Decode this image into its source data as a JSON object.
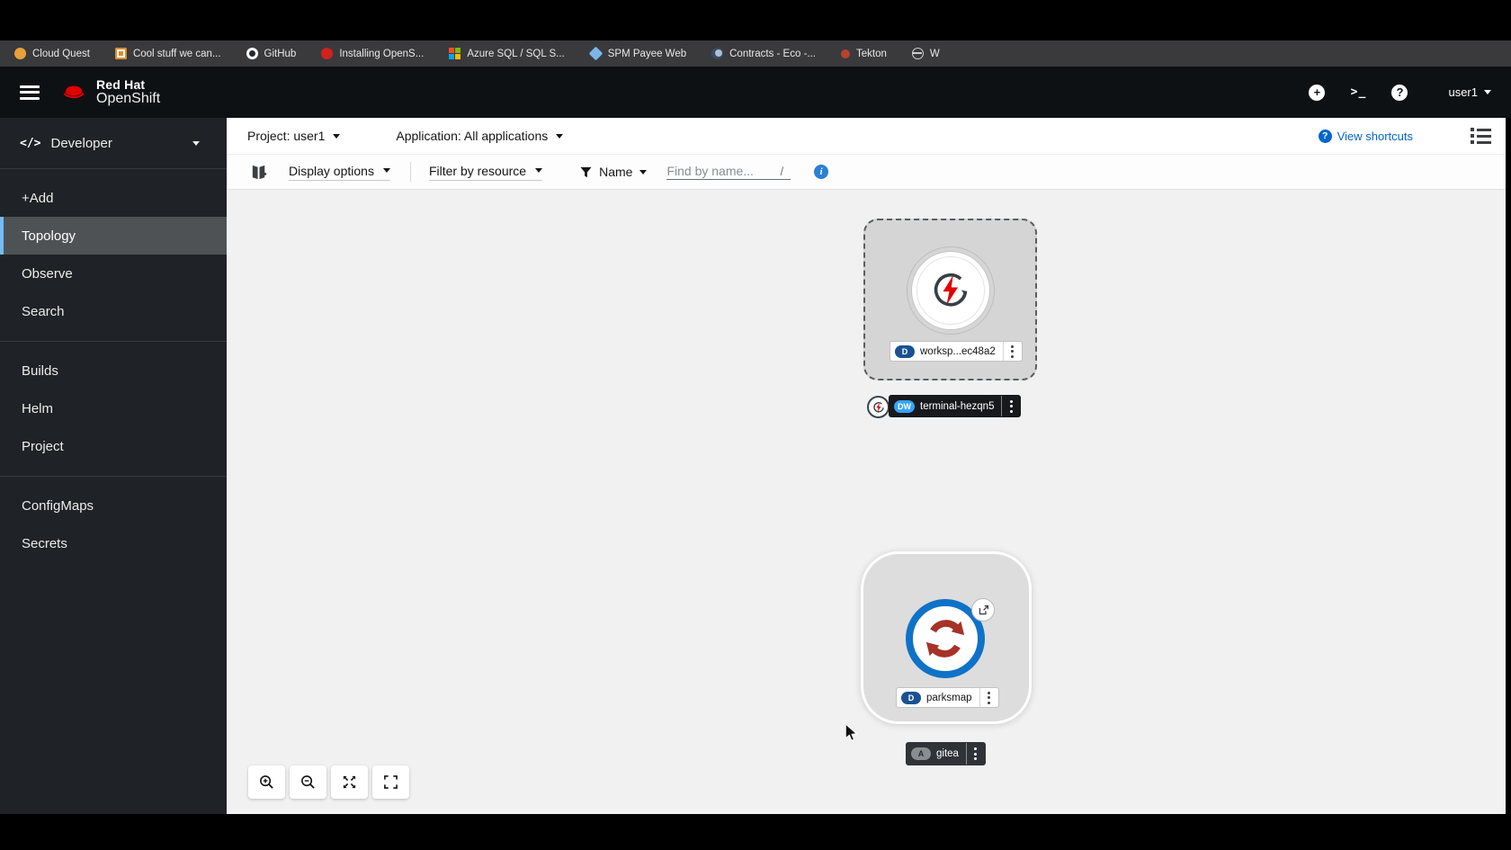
{
  "browser": {
    "bookmarks": [
      {
        "label": "Cloud Quest",
        "icon": "circle-favicon",
        "color": "#e9a13c"
      },
      {
        "label": "Cool stuff we can...",
        "icon": "square-favicon",
        "color": "#d98e2b"
      },
      {
        "label": "GitHub",
        "icon": "github-icon",
        "color": "#ffffff"
      },
      {
        "label": "Installing OpenS...",
        "icon": "circle-favicon",
        "color": "#d1221f"
      },
      {
        "label": "Azure SQL / SQL S...",
        "icon": "microsoft-squares-icon",
        "color": "#f25022"
      },
      {
        "label": "SPM Payee Web",
        "icon": "diamond-favicon",
        "color": "#7ab7e8"
      },
      {
        "label": "Contracts - Eco -...",
        "icon": "moon-favicon",
        "color": "#3b4a63"
      },
      {
        "label": "Tekton",
        "icon": "circle-favicon",
        "color": "#b5432f"
      },
      {
        "label": "W",
        "icon": "globe-icon",
        "color": "#cfcfcf"
      }
    ]
  },
  "masthead": {
    "brand_top": "Red Hat",
    "brand_bottom": "OpenShift",
    "username": "user1"
  },
  "sidebar": {
    "perspective_label": "Developer",
    "sections": [
      {
        "items": [
          {
            "label": "+Add",
            "selected": false
          },
          {
            "label": "Topology",
            "selected": true
          },
          {
            "label": "Observe",
            "selected": false
          },
          {
            "label": "Search",
            "selected": false
          }
        ]
      },
      {
        "items": [
          {
            "label": "Builds"
          },
          {
            "label": "Helm"
          },
          {
            "label": "Project"
          }
        ]
      },
      {
        "items": [
          {
            "label": "ConfigMaps"
          },
          {
            "label": "Secrets"
          }
        ]
      }
    ]
  },
  "context_bar": {
    "project_toggle": "Project: user1",
    "application_toggle": "Application: All applications",
    "view_shortcuts_label": "View shortcuts"
  },
  "topology_toolbar": {
    "display_options_label": "Display options",
    "filter_by_resource_label": "Filter by resource",
    "name_filter_label": "Name",
    "find_placeholder": "Find by name...",
    "shortcut_hint": "/"
  },
  "topology": {
    "workspace_node": {
      "badge": "D",
      "label": "worksp...ec48a2",
      "state": "selected-dashed"
    },
    "terminal_node": {
      "badge": "DW",
      "label": "terminal-hezqn5",
      "state": "highlighted"
    },
    "parksmap_node": {
      "badge": "D",
      "label": "parksmap",
      "state": "application-group"
    },
    "gitea_node": {
      "badge": "A",
      "label": "gitea",
      "state": "highlighted"
    }
  },
  "colors": {
    "masthead_bg": "#0e1114",
    "sidebar_bg": "#1f2226",
    "sidebar_selected_bg": "#4f5255",
    "sidebar_selected_border": "#73bcf7",
    "link_blue": "#0066cc",
    "info_blue": "#2b7fd4",
    "badge_deployment": "#1a5190",
    "badge_devworkspace": "#36a3f7",
    "badge_application": "#8a8d90",
    "parksmap_ring_blue": "#0f72c8",
    "parksmap_arrows_red": "#a63228",
    "devworkspace_bolt_red": "#e00000",
    "canvas_bg": "#f1f1f1"
  }
}
